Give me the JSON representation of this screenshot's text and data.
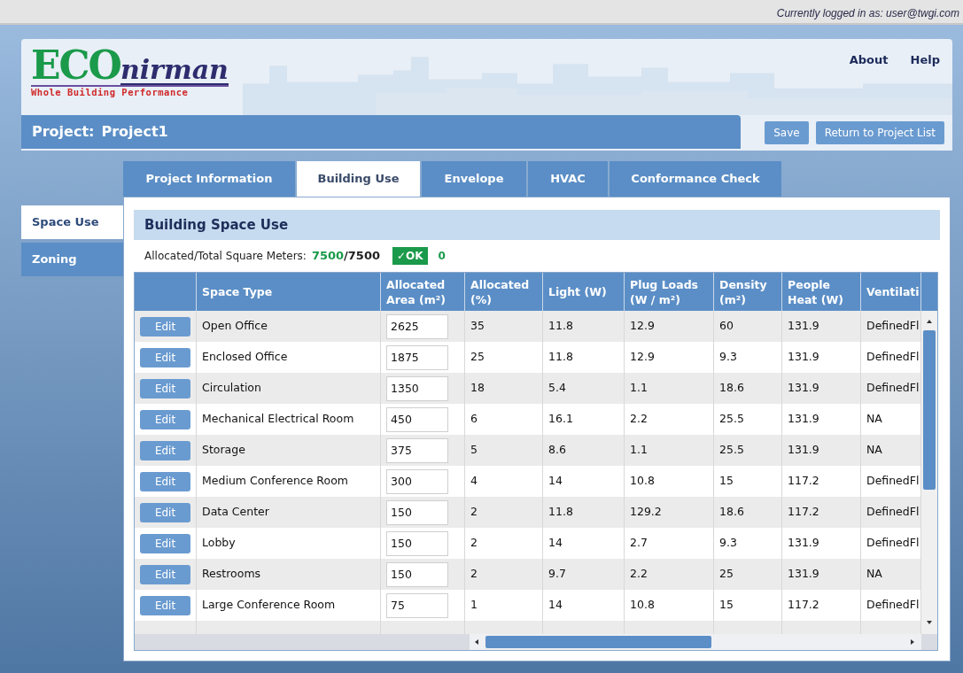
{
  "user_bar": {
    "text": "Currently logged in as:  user@twgi.com"
  },
  "header": {
    "logo": {
      "main": "ECO",
      "suffix": "nirman",
      "tagline": "Whole Building Performance"
    },
    "links": [
      "About",
      "Help"
    ]
  },
  "project_bar": {
    "label": "Project:",
    "name": "Project1",
    "buttons": [
      "Save",
      "Return to Project List"
    ]
  },
  "tabs": [
    {
      "label": "Project Information",
      "selected": false
    },
    {
      "label": "Building Use",
      "selected": true
    },
    {
      "label": "Envelope",
      "selected": false
    },
    {
      "label": "HVAC",
      "selected": false
    },
    {
      "label": "Conformance Check",
      "selected": false
    }
  ],
  "side_tabs": [
    {
      "label": "Space Use",
      "selected": true
    },
    {
      "label": "Zoning",
      "selected": false
    }
  ],
  "section": {
    "title": "Building Space Use",
    "summary": {
      "label": "Allocated/Total Square Meters:",
      "allocated": "7500",
      "separator": "/",
      "total": "7500",
      "status": "✓OK",
      "remainder": "0"
    }
  },
  "table": {
    "columns": [
      "Space Type",
      "Allocated Area (m²)",
      "Allocated (%)",
      "Light (W)",
      "Plug Loads (W / m²)",
      "Density (m²)",
      "People Heat (W)",
      "Ventilati"
    ],
    "rows": [
      {
        "action": "Edit",
        "cells": [
          "Open Office",
          "2625",
          "35",
          "11.8",
          "12.9",
          "60",
          "131.9",
          "DefinedFl"
        ]
      },
      {
        "action": "Edit",
        "cells": [
          "Enclosed Office",
          "1875",
          "25",
          "11.8",
          "12.9",
          "9.3",
          "131.9",
          "DefinedFl"
        ]
      },
      {
        "action": "Edit",
        "cells": [
          "Circulation",
          "1350",
          "18",
          "5.4",
          "1.1",
          "18.6",
          "131.9",
          "DefinedFl"
        ]
      },
      {
        "action": "Edit",
        "cells": [
          "Mechanical Electrical Room",
          "450",
          "6",
          "16.1",
          "2.2",
          "25.5",
          "131.9",
          "NA"
        ]
      },
      {
        "action": "Edit",
        "cells": [
          "Storage",
          "375",
          "5",
          "8.6",
          "1.1",
          "25.5",
          "131.9",
          "NA"
        ]
      },
      {
        "action": "Edit",
        "cells": [
          "Medium Conference Room",
          "300",
          "4",
          "14",
          "10.8",
          "15",
          "117.2",
          "DefinedFl"
        ]
      },
      {
        "action": "Edit",
        "cells": [
          "Data Center",
          "150",
          "2",
          "11.8",
          "129.2",
          "18.6",
          "117.2",
          "DefinedFl"
        ]
      },
      {
        "action": "Edit",
        "cells": [
          "Lobby",
          "150",
          "2",
          "14",
          "2.7",
          "9.3",
          "131.9",
          "DefinedFl"
        ]
      },
      {
        "action": "Edit",
        "cells": [
          "Restrooms",
          "150",
          "2",
          "9.7",
          "2.2",
          "25",
          "131.9",
          "NA"
        ]
      },
      {
        "action": "Edit",
        "cells": [
          "Large Conference Room",
          "75",
          "1",
          "14",
          "10.8",
          "15",
          "117.2",
          "DefinedFl"
        ]
      }
    ]
  }
}
